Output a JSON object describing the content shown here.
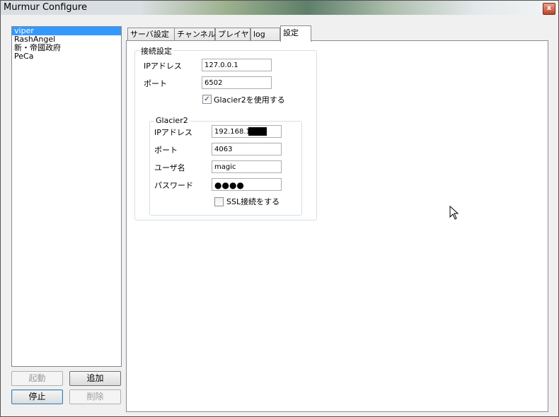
{
  "window": {
    "title": "Murmur Configure",
    "close_label": "x"
  },
  "servers": [
    "viper",
    "RashAngel",
    "新・帝國政府",
    "PeCa"
  ],
  "buttons": {
    "start": "起動",
    "add": "追加",
    "stop": "停止",
    "delete": "削除"
  },
  "tabs": [
    "サーバ設定",
    "チャンネル",
    "プレイヤ",
    "log",
    "設定"
  ],
  "active_tab": "設定",
  "connection": {
    "group_label": "接続設定",
    "ip_label": "IPアドレス",
    "ip_value": "127.0.0.1",
    "port_label": "ポート",
    "port_value": "6502",
    "glacier_checkbox_label": "Glacier2を使用する",
    "glacier_checked": true
  },
  "glacier2": {
    "group_label": "Glacier2",
    "ip_label": "IPアドレス",
    "ip_value": "192.168.1",
    "port_label": "ポート",
    "port_value": "4063",
    "user_label": "ユーザ名",
    "user_value": "magic",
    "password_label": "パスワード",
    "password_mask": "●●●●",
    "ssl_label": "SSL接続をする",
    "ssl_checked": false
  }
}
